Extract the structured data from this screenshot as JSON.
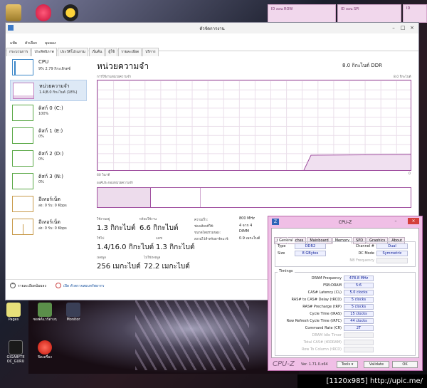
{
  "desktop": {
    "top_icons": [
      "folder-icon",
      "music-app-icon",
      "media-player-icon"
    ],
    "pink_windows": [
      "ID ลอน ROW",
      "ID ลอน SPI"
    ],
    "pink_window3_text": "ID",
    "desk_icons": [
      {
        "label": "Pages",
        "icon": "app-icon"
      },
      {
        "label": "ซอฟต์แวร์ต่างๆ",
        "icon": "folder-icon"
      },
      {
        "label": "Monitor",
        "icon": "monitor-icon"
      },
      {
        "label": "GIGABYTE OC_GURU",
        "icon": "gigabyte-icon"
      },
      {
        "label": "ปิดเครื่อง",
        "icon": "power-icon"
      }
    ],
    "banner": "[1120x985] http://upic.me/"
  },
  "taskmanager": {
    "title": "ตัวจัดการงาน",
    "menu": [
      "แฟ้ม",
      "ตัวเลือก",
      "มุมมอง"
    ],
    "tabs": [
      "กระบวนการ",
      "ประสิทธิภาพ",
      "ประวัติโปรแกรม",
      "เริ่มต้น",
      "ผู้ใช้",
      "รายละเอียด",
      "บริการ"
    ],
    "sidebar": [
      {
        "title": "CPU",
        "sub": "9% 2.79 กิกะเฮิรตซ์"
      },
      {
        "title": "หน่วยความจำ",
        "sub": "1.4/8.0 กิกะไบต์ (18%)"
      },
      {
        "title": "ดิสก์ 0 (C:)",
        "sub": "100%"
      },
      {
        "title": "ดิสก์ 1 (E:)",
        "sub": "0%"
      },
      {
        "title": "ดิสก์ 2 (D:)",
        "sub": "0%"
      },
      {
        "title": "ดิสก์ 3 (N:)",
        "sub": "0%"
      },
      {
        "title": "อีเทอร์เน็ต",
        "sub": "ส่ง: 0 รับ: 0 Kbps"
      },
      {
        "title": "อีเทอร์เน็ต",
        "sub": "ส่ง: 0 รับ: 0 Kbps"
      }
    ],
    "heading": "หน่วยความจำ",
    "total": "8.0 กิกะไบต์ DDR",
    "chart_label": "การใช้งานหน่วยความจำ",
    "chart_max": "8.0 กิกะไบต์",
    "time_label": "60 วินาที",
    "zero_label": "0",
    "composition_label": "องค์ประกอบหน่วยความจำ",
    "stats": [
      {
        "label": "ใช้งานอยู่",
        "value": "1.3 กิกะไบต์"
      },
      {
        "label": "พร้อมใช้งาน",
        "value": "6.6 กิกะไบต์"
      },
      {
        "label": "ใช้ไป",
        "value": "1.4/16.0 กิกะไบต์"
      },
      {
        "label": "แคช",
        "value": "1.3 กิกะไบต์"
      },
      {
        "label": "เพจพูล",
        "value": "256 เมกะไบต์"
      },
      {
        "label": "ไม่ใช่เพจพูล",
        "value": "72.2 เมกะไบต์"
      }
    ],
    "kv": [
      {
        "label": "ความเร็ว:",
        "value": "800 MHz"
      },
      {
        "label": "ช่องเสียบที่ใช้:",
        "value": "4 จาก 4"
      },
      {
        "label": "ขนาดโดยรวมของ:",
        "value": "DIMM"
      },
      {
        "label": "สงวนไว้สำหรับฮาร์ดแวร์:",
        "value": "0.9 เมกะไบต์"
      }
    ],
    "footer_less": "รายละเอียดน้อยลง",
    "footer_monitor": "เปิด ตัวตรวจสอบทรัพยากร"
  },
  "cpuz": {
    "title": "CPU-Z",
    "logo": "Z",
    "tabs": [
      "CPU",
      "Caches",
      "Mainboard",
      "Memory",
      "SPD",
      "Graphics",
      "About"
    ],
    "general_title": "General",
    "type_label": "Type",
    "type": "DDR2",
    "size_label": "Size",
    "size": "8 GBytes",
    "channel_label": "Channel #",
    "channel": "Dual",
    "dcmode_label": "DC Mode",
    "dcmode": "Symmetric",
    "nbfreq_label": "NB Frequency",
    "timings_title": "Timings",
    "timings": [
      {
        "label": "DRAM Frequency",
        "value": "478.8 MHz",
        "dim": false
      },
      {
        "label": "FSB:DRAM",
        "value": "5:6",
        "dim": false
      },
      {
        "label": "CAS# Latency (CL)",
        "value": "5.0 clocks",
        "dim": false
      },
      {
        "label": "RAS# to CAS# Delay (tRCD)",
        "value": "5 clocks",
        "dim": false
      },
      {
        "label": "RAS# Precharge (tRP)",
        "value": "5 clocks",
        "dim": false
      },
      {
        "label": "Cycle Time (tRAS)",
        "value": "15 clocks",
        "dim": false
      },
      {
        "label": "Row Refresh Cycle Time (tRFC)",
        "value": "44 clocks",
        "dim": false
      },
      {
        "label": "Command Rate (CR)",
        "value": "2T",
        "dim": false
      },
      {
        "label": "DRAM Idle Timer",
        "value": "",
        "dim": true
      },
      {
        "label": "Total CAS# (tRDRAM)",
        "value": "",
        "dim": true
      },
      {
        "label": "Row To Column (tRCD)",
        "value": "",
        "dim": true
      }
    ],
    "brand": "CPU-Z",
    "version": "Ver. 1.71.0.x64",
    "tools_label": "Tools",
    "validate_label": "Validate",
    "ok_label": "OK"
  }
}
